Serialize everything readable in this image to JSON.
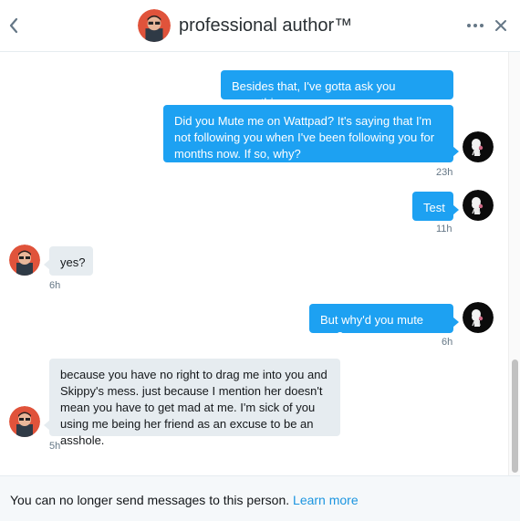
{
  "header": {
    "title": "professional author™",
    "back_icon": "chevron-left-icon",
    "more_icon": "more-horizontal-icon",
    "close_icon": "close-icon"
  },
  "messages": [
    {
      "direction": "out",
      "text": "Besides that, I've gotta ask you something."
    },
    {
      "direction": "out",
      "text": "Did you Mute me on Wattpad? It's saying that I'm not following you when I've been following you for months now. If so, why?",
      "time": "23h"
    },
    {
      "direction": "out",
      "text": "Test",
      "time": "11h"
    },
    {
      "direction": "in",
      "text": "yes?",
      "time": "6h"
    },
    {
      "direction": "out",
      "text": "But why'd you mute me?",
      "time": "6h"
    },
    {
      "direction": "in",
      "text": "because you have no right to drag me into you and Skippy's mess. just because I mention her doesn't mean you have to get mad at me. I'm sick of you using me being her friend as an excuse to be an asshole.",
      "time": "5h"
    }
  ],
  "footer": {
    "notice": "You can no longer send messages to this person.",
    "link": "Learn more"
  },
  "colors": {
    "accent": "#1da1f2",
    "link": "#1b95e0",
    "incoming_bubble": "#e6ecf0",
    "footer_bg": "#f5f8fa"
  }
}
